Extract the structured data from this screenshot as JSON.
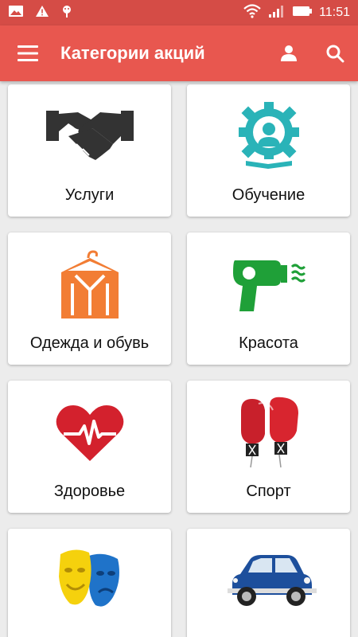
{
  "status_bar": {
    "time": "11:51"
  },
  "app_bar": {
    "title": "Категории акций",
    "menu_icon": "hamburger-menu-icon",
    "profile_icon": "person-icon",
    "search_icon": "search-icon",
    "background": "#e8574f"
  },
  "categories": [
    {
      "label": "Услуги",
      "icon": "handshake-icon"
    },
    {
      "label": "Обучение",
      "icon": "gear-person-icon"
    },
    {
      "label": "Одежда и обувь",
      "icon": "clothes-hanger-icon"
    },
    {
      "label": "Красота",
      "icon": "hair-dryer-icon"
    },
    {
      "label": "Здоровье",
      "icon": "heart-pulse-icon"
    },
    {
      "label": "Спорт",
      "icon": "boxing-gloves-icon"
    },
    {
      "label": "",
      "icon": "theater-masks-icon"
    },
    {
      "label": "",
      "icon": "car-icon"
    }
  ]
}
